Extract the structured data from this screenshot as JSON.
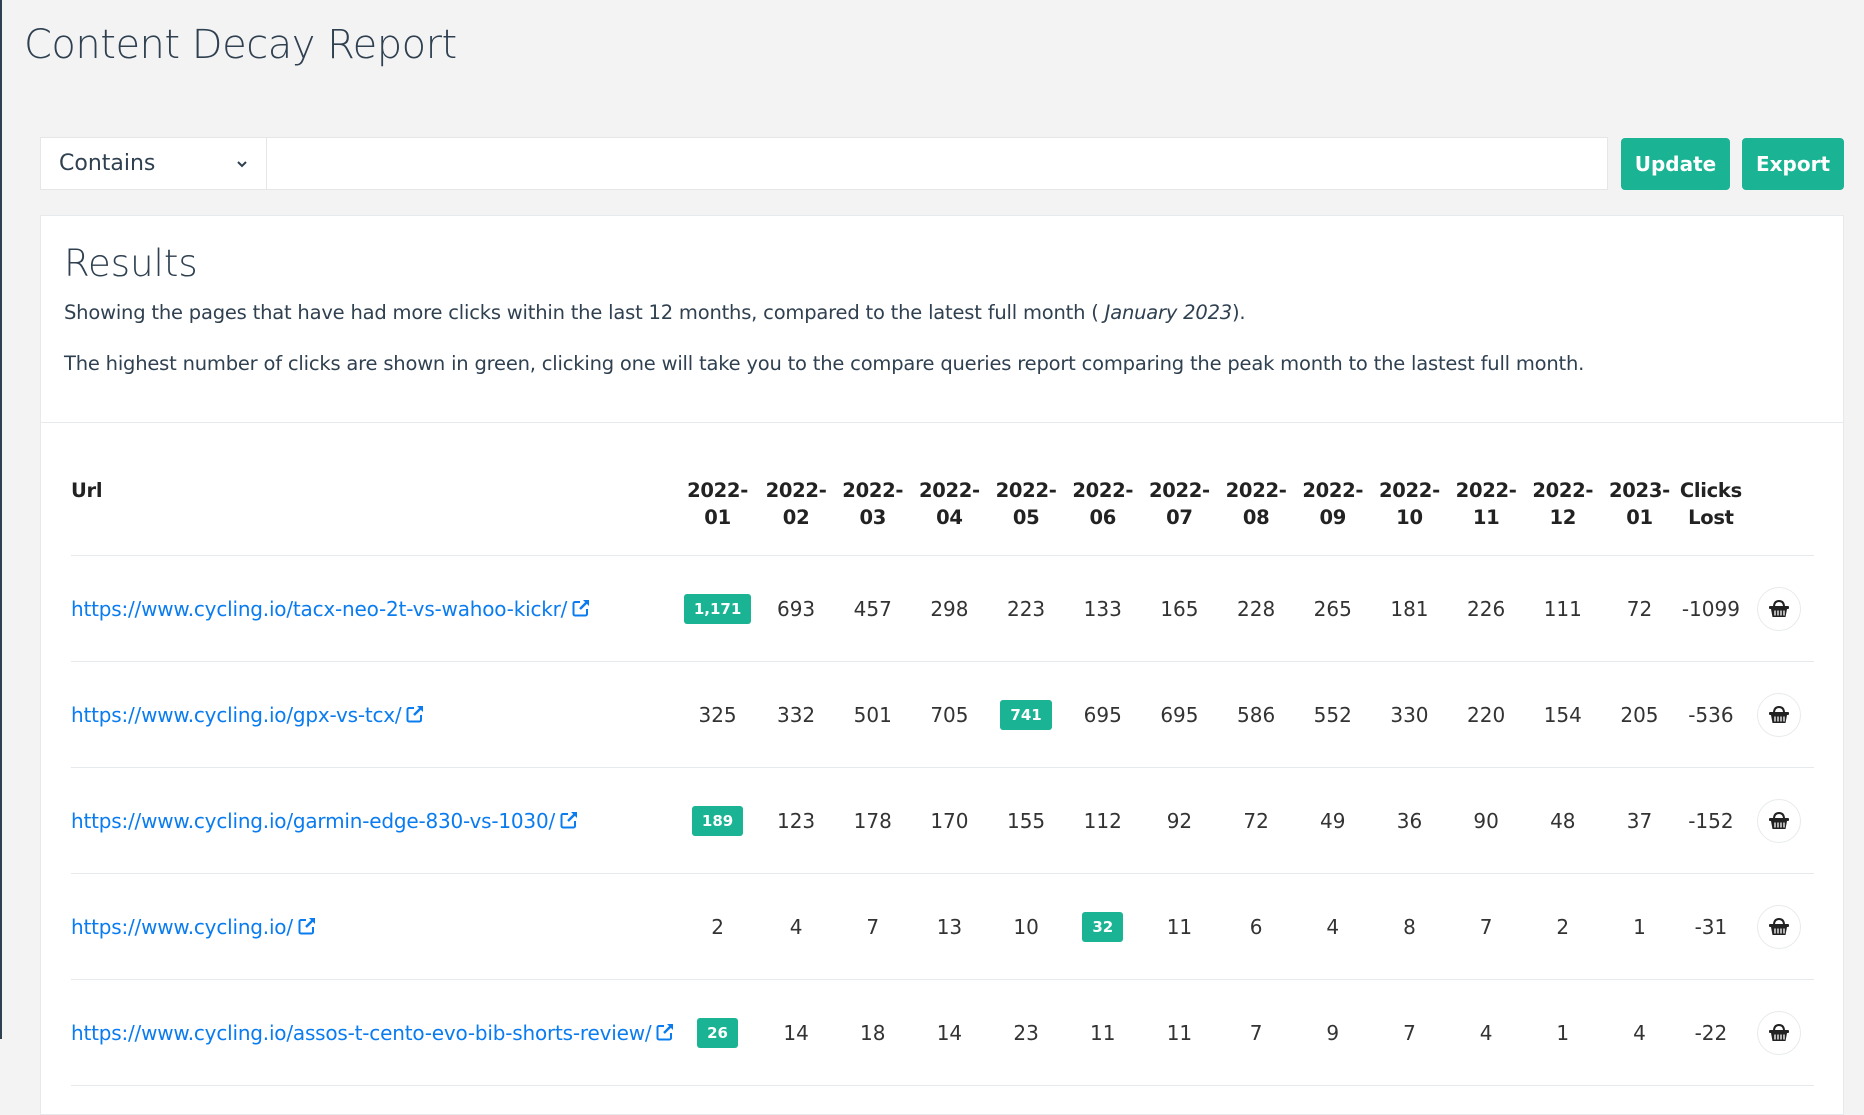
{
  "page": {
    "title": "Content Decay Report"
  },
  "filter": {
    "select_value": "Contains",
    "input_value": "",
    "input_placeholder": "",
    "update_label": "Update",
    "export_label": "Export"
  },
  "results": {
    "title": "Results",
    "description_prefix": "Showing the pages that have had more clicks within the last 12 months, compared to the latest full month ( ",
    "description_month": "January 2023",
    "description_suffix": ").",
    "note": "The highest number of clicks are shown in green, clicking one will take you to the compare queries report comparing the peak month to the lastest full month."
  },
  "table": {
    "url_header": "Url",
    "month_headers": [
      "2022-01",
      "2022-02",
      "2022-03",
      "2022-04",
      "2022-05",
      "2022-06",
      "2022-07",
      "2022-08",
      "2022-09",
      "2022-10",
      "2022-11",
      "2022-12",
      "2023-01"
    ],
    "clicks_lost_header_line1": "Clicks",
    "clicks_lost_header_line2": "Lost",
    "rows": [
      {
        "url": "https://www.cycling.io/tacx-neo-2t-vs-wahoo-kickr/",
        "values": [
          "1,171",
          "693",
          "457",
          "298",
          "223",
          "133",
          "165",
          "228",
          "265",
          "181",
          "226",
          "111",
          "72"
        ],
        "peak_index": 0,
        "clicks_lost": "-1099"
      },
      {
        "url": "https://www.cycling.io/gpx-vs-tcx/",
        "values": [
          "325",
          "332",
          "501",
          "705",
          "741",
          "695",
          "695",
          "586",
          "552",
          "330",
          "220",
          "154",
          "205"
        ],
        "peak_index": 4,
        "clicks_lost": "-536"
      },
      {
        "url": "https://www.cycling.io/garmin-edge-830-vs-1030/",
        "values": [
          "189",
          "123",
          "178",
          "170",
          "155",
          "112",
          "92",
          "72",
          "49",
          "36",
          "90",
          "48",
          "37"
        ],
        "peak_index": 0,
        "clicks_lost": "-152"
      },
      {
        "url": "https://www.cycling.io/",
        "values": [
          "2",
          "4",
          "7",
          "13",
          "10",
          "32",
          "11",
          "6",
          "4",
          "8",
          "7",
          "2",
          "1"
        ],
        "peak_index": 5,
        "clicks_lost": "-31"
      },
      {
        "url": "https://www.cycling.io/assos-t-cento-evo-bib-shorts-review/",
        "values": [
          "26",
          "14",
          "18",
          "14",
          "23",
          "11",
          "11",
          "7",
          "9",
          "7",
          "4",
          "1",
          "4"
        ],
        "peak_index": 0,
        "clicks_lost": "-22"
      }
    ]
  },
  "icons": {
    "select_chevron": "chevron-down-icon",
    "external_link": "external-link-icon",
    "row_action": "basket-icon"
  },
  "colors": {
    "accent": "#1ab394",
    "link": "#0a7cf0",
    "text": "#2f4050"
  }
}
